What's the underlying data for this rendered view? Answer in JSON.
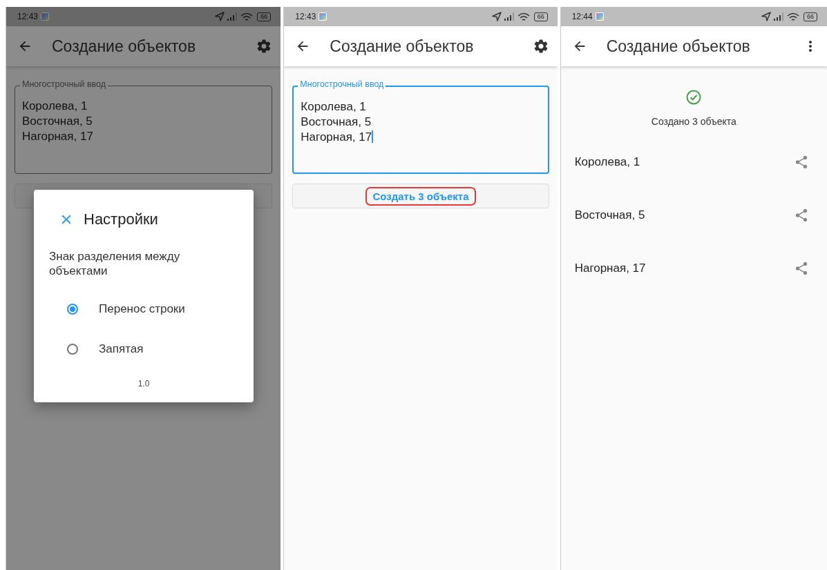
{
  "screens": [
    {
      "kind": "editor",
      "status": {
        "time": "12:43",
        "battery": "66"
      },
      "title": "Создание объектов",
      "dimmed": true,
      "field": {
        "label": "Многострочный ввод",
        "value": "Королева, 1\nВосточная, 5\nНагорная, 17",
        "focused": false
      },
      "dialog": {
        "title": "Настройки",
        "prompt": "Знак разделения между объектами",
        "options": [
          {
            "label": "Перенос строки",
            "selected": true
          },
          {
            "label": "Запятая",
            "selected": false
          }
        ],
        "version": "1.0"
      }
    },
    {
      "kind": "editor",
      "status": {
        "time": "12:43",
        "battery": "66"
      },
      "title": "Создание объектов",
      "dimmed": false,
      "field": {
        "label": "Многострочный ввод",
        "value": "Королева, 1\nВосточная, 5\nНагорная, 17",
        "focused": true
      },
      "button": {
        "label": "Создать 3 объекта",
        "highlighted": true
      }
    },
    {
      "kind": "result",
      "status": {
        "time": "12:44",
        "battery": "66"
      },
      "title": "Создание объектов",
      "dimmed": false,
      "message": "Создано 3 объекта",
      "items": [
        "Королева, 1",
        "Восточная, 5",
        "Нагорная, 17"
      ]
    }
  ]
}
